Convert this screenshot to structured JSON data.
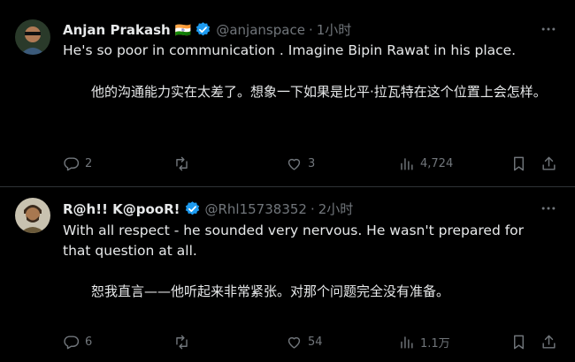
{
  "tweets": [
    {
      "author_name": "Anjan Prakash",
      "flag": "🇮🇳",
      "handle": "@anjanspace",
      "separator": "·",
      "time": "1小时",
      "text_en": "He's so poor in communication . Imagine Bipin Rawat in his place.",
      "text_zh": "他的沟通能力实在太差了。想象一下如果是比平·拉瓦特在这个位置上会怎样。",
      "replies": "2",
      "retweets": "",
      "likes": "3",
      "views": "4,724"
    },
    {
      "author_name": "R@h!! K@pooR!",
      "flag": "",
      "handle": "@Rhl15738352",
      "separator": "·",
      "time": "2小时",
      "text_en": "With all respect - he sounded very nervous. He wasn't prepared for that question at all.",
      "text_zh": "恕我直言——他听起来非常紧张。对那个问题完全没有准备。",
      "replies": "6",
      "retweets": "",
      "likes": "54",
      "views": "1.1万"
    }
  ],
  "colors": {
    "background": "#000000",
    "text": "#e7e9ea",
    "muted": "#71767b",
    "verified": "#1d9bf0",
    "divider": "#2f3336"
  },
  "icons": [
    "verified-badge-icon",
    "more-icon",
    "reply-icon",
    "retweet-icon",
    "like-icon",
    "views-icon",
    "bookmark-icon",
    "share-icon"
  ]
}
